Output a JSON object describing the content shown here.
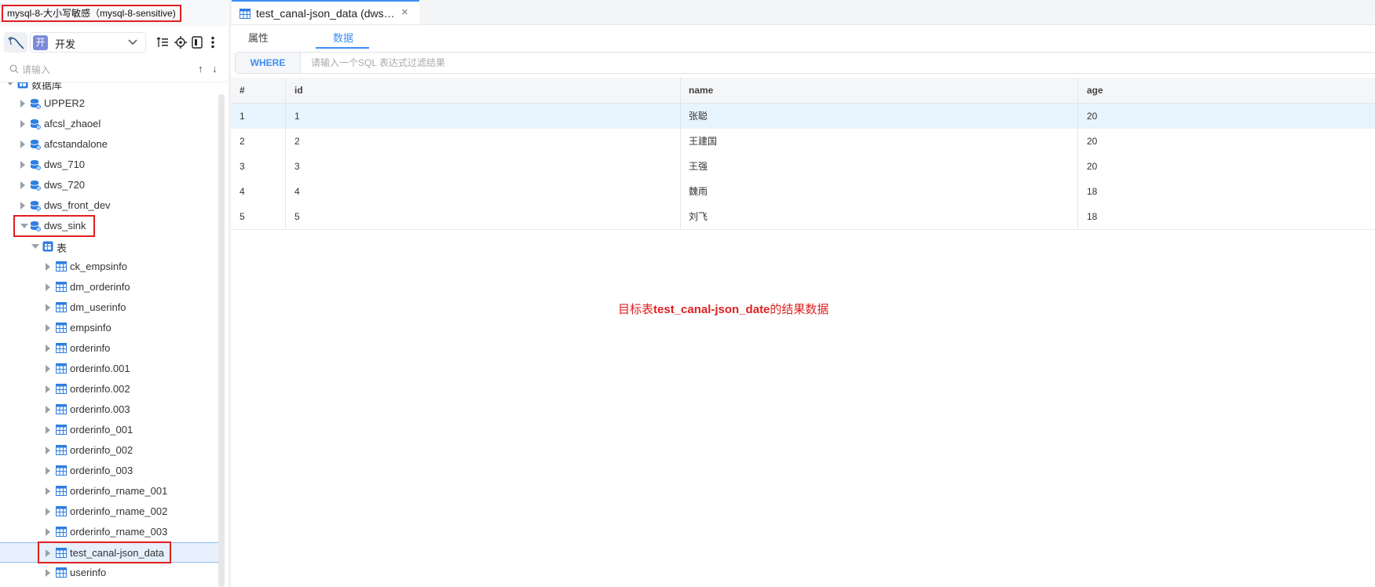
{
  "sidebar": {
    "connection_title": "mysql-8-大小写敏感（mysql-8-sensitive)",
    "env_badge": "开",
    "env_label": "开发",
    "search_placeholder": "请输入",
    "sort_up": "↑",
    "sort_down": "↓",
    "tree": {
      "root_label": "数据库",
      "databases": [
        "UPPER2",
        "afcsl_zhaoel",
        "afcstandalone",
        "dws_710",
        "dws_720",
        "dws_front_dev"
      ],
      "expanded_db": "dws_sink",
      "table_group": "表",
      "tables": [
        "ck_empsinfo",
        "dm_orderinfo",
        "dm_userinfo",
        "empsinfo",
        "orderinfo",
        "orderinfo.001",
        "orderinfo.002",
        "orderinfo.003",
        "orderinfo_001",
        "orderinfo_002",
        "orderinfo_003",
        "orderinfo_rname_001",
        "orderinfo_rname_002",
        "orderinfo_rname_003",
        "test_canal-json_data",
        "userinfo"
      ]
    }
  },
  "main": {
    "tab_title": "test_canal-json_data (dws…",
    "tab_close": "×",
    "subtabs": [
      "属性",
      "数据"
    ],
    "where_label": "WHERE",
    "where_placeholder": "请输入一个SQL 表达式过滤结果",
    "grid": {
      "columns": [
        "#",
        "id",
        "name",
        "age"
      ],
      "rows": [
        [
          "1",
          "1",
          "张聪",
          "20"
        ],
        [
          "2",
          "2",
          "王建国",
          "20"
        ],
        [
          "3",
          "3",
          "王强",
          "20"
        ],
        [
          "4",
          "4",
          "魏雨",
          "18"
        ],
        [
          "5",
          "5",
          "刘飞",
          "18"
        ]
      ]
    },
    "annotation": {
      "prefix": "目标表",
      "table": "test_canal-json_date",
      "suffix": "的结果数据"
    }
  },
  "colors": {
    "accent": "#3c8ff5",
    "highlight_red": "#e02020",
    "db_icon": "#2f7de1",
    "selected_row": "#e6f1fd"
  }
}
